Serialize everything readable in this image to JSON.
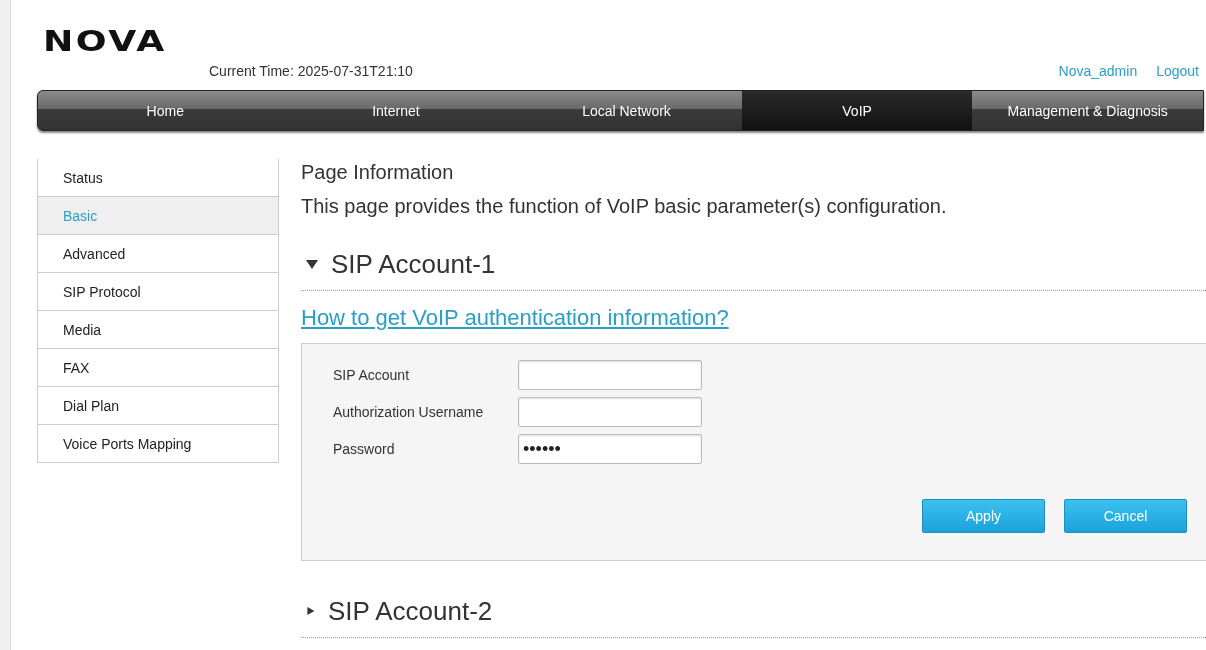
{
  "header": {
    "logo": "NOVA",
    "current_time": "Current Time: 2025-07-31T21:10",
    "user_links": [
      "Nova_admin",
      "Logout"
    ]
  },
  "nav": [
    {
      "label": "Home",
      "selected": false
    },
    {
      "label": "Internet",
      "selected": false
    },
    {
      "label": "Local Network",
      "selected": false
    },
    {
      "label": "VoIP",
      "selected": true
    },
    {
      "label": "Management & Diagnosis",
      "selected": false
    }
  ],
  "sidebar": {
    "items": [
      {
        "label": "Status",
        "selected": false
      },
      {
        "label": "Basic",
        "selected": true
      },
      {
        "label": "Advanced",
        "selected": false
      },
      {
        "label": "SIP Protocol",
        "selected": false
      },
      {
        "label": "Media",
        "selected": false
      },
      {
        "label": "FAX",
        "selected": false
      },
      {
        "label": "Dial Plan",
        "selected": false
      },
      {
        "label": "Voice Ports Mapping",
        "selected": false
      }
    ]
  },
  "page_info": {
    "title": "Page Information",
    "description": "This page provides the function of VoIP basic parameter(s) configuration."
  },
  "sections": [
    {
      "title": "SIP Account-1",
      "expanded": true,
      "help_link": "How to get VoIP authentication information?",
      "fields": [
        {
          "label": "SIP Account"
        },
        {
          "label": "Authorization Username"
        },
        {
          "label": "Password",
          "value": "••••••"
        }
      ],
      "buttons": [
        "Apply",
        "Cancel"
      ]
    },
    {
      "title": "SIP Account-2",
      "expanded": false
    }
  ]
}
